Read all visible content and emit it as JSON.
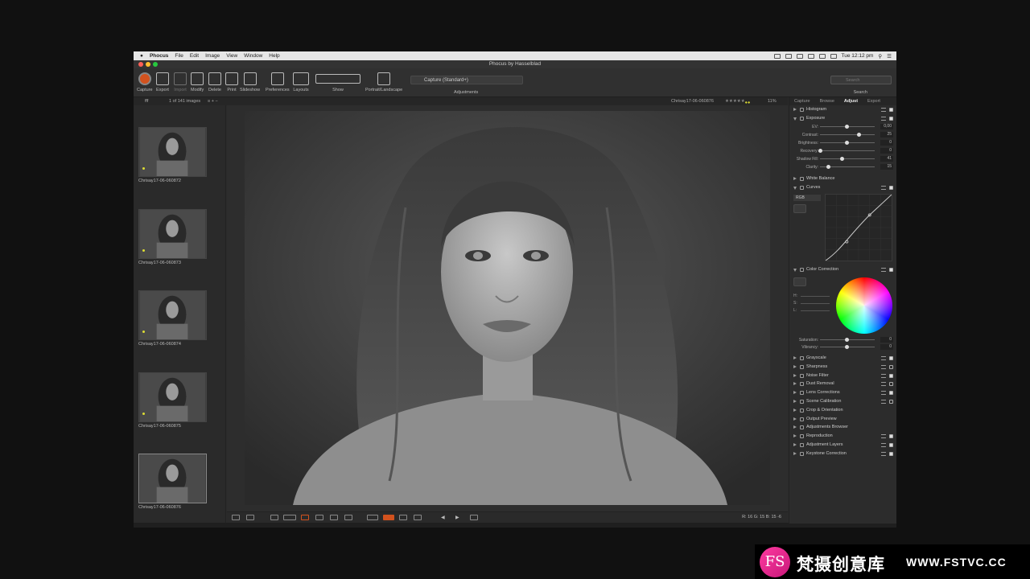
{
  "menubar": {
    "apple": "",
    "items": [
      "Phocus",
      "File",
      "Edit",
      "Image",
      "View",
      "Window",
      "Help"
    ],
    "clock": "Tue 12:12 pm"
  },
  "window": {
    "title": "Phocus by Hasselblad"
  },
  "toolbar": {
    "buttons": [
      "Capture",
      "Export",
      "Import",
      "Modify",
      "Delete",
      "Print",
      "Slideshow",
      "Preferences",
      "Layouts",
      "Show",
      "Portrait/Landscape"
    ],
    "capture_preset": "Capture (Standard+)",
    "adjustments_label": "Adjustments",
    "search_placeholder": "Search",
    "search_label": "Search"
  },
  "subbar": {
    "folder": "fff",
    "image_count": "1 of 141 images",
    "current_file": "Chrisay17-06-060876",
    "zoom": "11%"
  },
  "browser": {
    "thumbnails": [
      {
        "name": "Chrisay17-06-060872"
      },
      {
        "name": "Chrisay17-06-060873"
      },
      {
        "name": "Chrisay17-06-060874"
      },
      {
        "name": "Chrisay17-06-060875"
      },
      {
        "name": "Chrisay17-06-060876"
      }
    ]
  },
  "viewer": {
    "readout": "R: 16  G: 15  B: 15  -6"
  },
  "panel": {
    "tabs": [
      "Capture",
      "Browse",
      "Adjust",
      "Export"
    ],
    "active_tab": "Adjust",
    "histogram": "Histogram",
    "exposure": {
      "title": "Exposure",
      "sliders": [
        {
          "label": "EV:",
          "value": "0,00",
          "level": 0.5
        },
        {
          "label": "Contrast:",
          "value": "25",
          "level": 0.72
        },
        {
          "label": "Brightness:",
          "value": "0",
          "level": 0.5
        },
        {
          "label": "Recovery:",
          "value": "0",
          "level": 0.0
        },
        {
          "label": "Shadow Fill:",
          "value": "41",
          "level": 0.41
        },
        {
          "label": "Clarity:",
          "value": "15",
          "level": 0.15
        }
      ]
    },
    "white_balance": "White Balance",
    "curves": {
      "title": "Curves",
      "channel": "RGB"
    },
    "color_correction": {
      "title": "Color Correction",
      "hsl": [
        "H:",
        "S:",
        "L:"
      ],
      "sliders": [
        {
          "label": "Saturation:",
          "value": "0",
          "level": 0.5
        },
        {
          "label": "Vibrancy:",
          "value": "0",
          "level": 0.5
        }
      ]
    },
    "sections": [
      {
        "title": "Grayscale",
        "checked": true
      },
      {
        "title": "Sharpness",
        "checked": false
      },
      {
        "title": "Noise Filter",
        "checked": true
      },
      {
        "title": "Dust Removal",
        "checked": false
      },
      {
        "title": "Lens Corrections",
        "checked": true
      },
      {
        "title": "Scene Calibration",
        "checked": false
      },
      {
        "title": "Crop & Orientation",
        "checked": null
      },
      {
        "title": "Output Preview",
        "checked": null
      },
      {
        "title": "Adjustments Browser",
        "checked": null
      },
      {
        "title": "Reproduction",
        "checked": true
      },
      {
        "title": "Adjustment Layers",
        "checked": true
      },
      {
        "title": "Keystone Correction",
        "checked": true
      }
    ]
  },
  "watermark": {
    "logo": "FS",
    "brand": "梵摄创意库",
    "url": "WWW.FSTVC.CC"
  },
  "colors": {
    "capture_red": "#d2521e",
    "rating_yellow": "#dddd33",
    "watermark_pink": "#ff3aa0"
  }
}
